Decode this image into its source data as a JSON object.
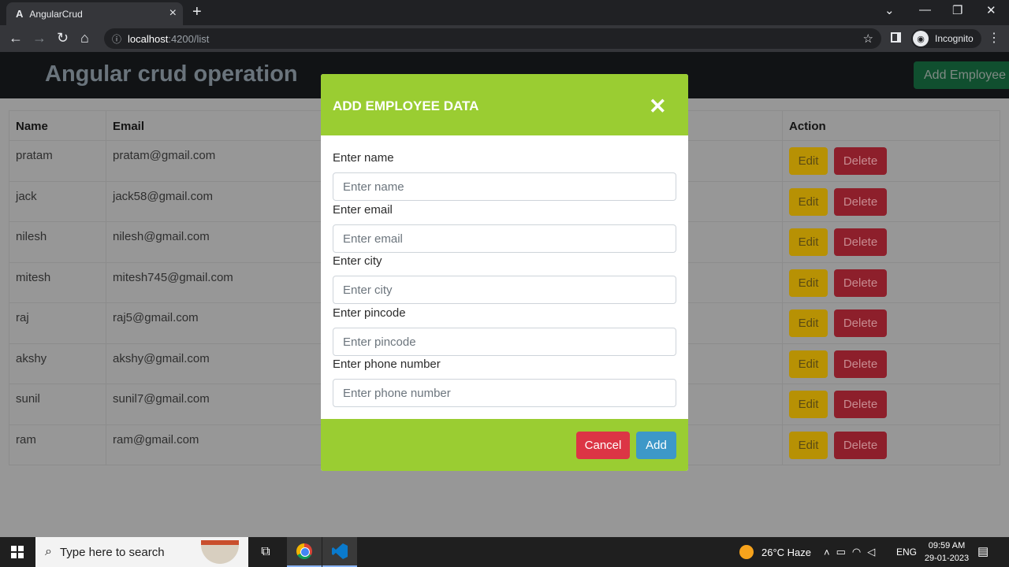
{
  "browser": {
    "tab_title": "AngularCrud",
    "tab_favicon": "A",
    "url_host": "localhost",
    "url_path": ":4200/list",
    "profile_label": "Incognito"
  },
  "page": {
    "title": "Angular crud operation",
    "add_button": "Add Employee"
  },
  "table": {
    "headers": {
      "name": "Name",
      "email": "Email",
      "action": "Action"
    },
    "edit_label": "Edit",
    "delete_label": "Delete",
    "rows": [
      {
        "name": "pratam",
        "email": "pratam@gmail.com"
      },
      {
        "name": "jack",
        "email": "jack58@gmail.com"
      },
      {
        "name": "nilesh",
        "email": "nilesh@gmail.com"
      },
      {
        "name": "mitesh",
        "email": "mitesh745@gmail.com"
      },
      {
        "name": "raj",
        "email": "raj5@gmail.com"
      },
      {
        "name": "akshy",
        "email": "akshy@gmail.com"
      },
      {
        "name": "sunil",
        "email": "sunil7@gmail.com"
      },
      {
        "name": "ram",
        "email": "ram@gmail.com"
      }
    ]
  },
  "modal": {
    "title": "ADD EMPLOYEE DATA",
    "close_glyph": "✕",
    "fields": [
      {
        "label": "Enter name",
        "placeholder": "Enter name",
        "value": ""
      },
      {
        "label": "Enter email",
        "placeholder": "Enter email",
        "value": ""
      },
      {
        "label": "Enter city",
        "placeholder": "Enter city",
        "value": ""
      },
      {
        "label": "Enter pincode",
        "placeholder": "Enter pincode",
        "value": ""
      },
      {
        "label": "Enter phone number",
        "placeholder": "Enter phone number",
        "value": ""
      }
    ],
    "cancel_label": "Cancel",
    "add_label": "Add",
    "accent_color": "#9acd32"
  },
  "taskbar": {
    "search_placeholder": "Type here to search",
    "weather": "26°C  Haze",
    "language": "ENG",
    "time": "09:59 AM",
    "date": "29-01-2023"
  }
}
